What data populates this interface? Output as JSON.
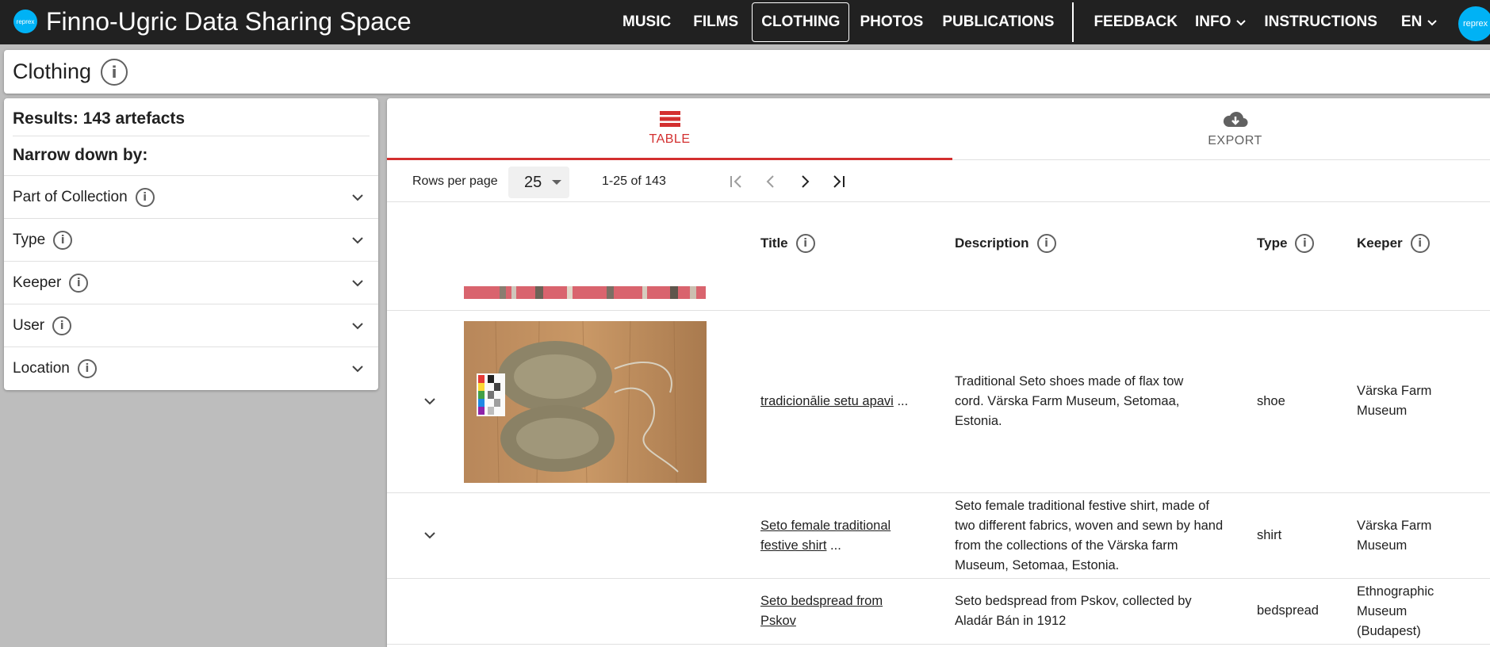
{
  "app": {
    "logo_text": "reprex",
    "title": "Finno-Ugric Data Sharing Space",
    "avatar_text": "reprex"
  },
  "nav": {
    "music": "MUSIC",
    "films": "FILMS",
    "clothing": "CLOTHING",
    "photos": "PHOTOS",
    "publications": "PUBLICATIONS",
    "feedback": "FEEDBACK",
    "info": "INFO",
    "instructions": "INSTRUCTIONS",
    "language": "EN"
  },
  "page": {
    "title": "Clothing"
  },
  "sidebar": {
    "results": "Results: 143 artefacts",
    "narrow": "Narrow down by:",
    "filters": [
      {
        "label": "Part of Collection"
      },
      {
        "label": "Type"
      },
      {
        "label": "Keeper"
      },
      {
        "label": "User"
      },
      {
        "label": "Location"
      }
    ]
  },
  "tabs": {
    "table": "TABLE",
    "export": "EXPORT"
  },
  "pager": {
    "rows_label": "Rows per page",
    "rows_value": "25",
    "range": "1-25 of 143"
  },
  "columns": {
    "title": "Title",
    "description": "Description",
    "type": "Type",
    "keeper": "Keeper"
  },
  "rows": [
    {
      "title_line1": "tradicionālie setu apavi",
      "title_suffix": " ...",
      "description": "Traditional Seto shoes made of flax tow cord. Värska Farm Museum, Setomaa, Estonia.",
      "type": "shoe",
      "keeper": "Värska Farm Museum"
    },
    {
      "title_line1": "Seto female traditional",
      "title_line2": "festive shirt",
      "title_suffix": " ...",
      "description": "Seto female traditional festive shirt, made of two different fabrics, woven and sewn by hand from the collections of the Värska farm Museum, Setomaa, Estonia.",
      "type": "shirt",
      "keeper": "Värska Farm Museum"
    },
    {
      "title_line1": "Seto bedspread from",
      "title_line2": "Pskov",
      "description": "Seto bedspread from Pskov, collected by Aladár Bán in 1912",
      "type": "bedspread",
      "keeper": "Ethnographic Museum (Budapest)"
    }
  ],
  "colors": {
    "topbar": "#212121",
    "accent": "#d32f2f",
    "logo": "#00b2f5"
  }
}
